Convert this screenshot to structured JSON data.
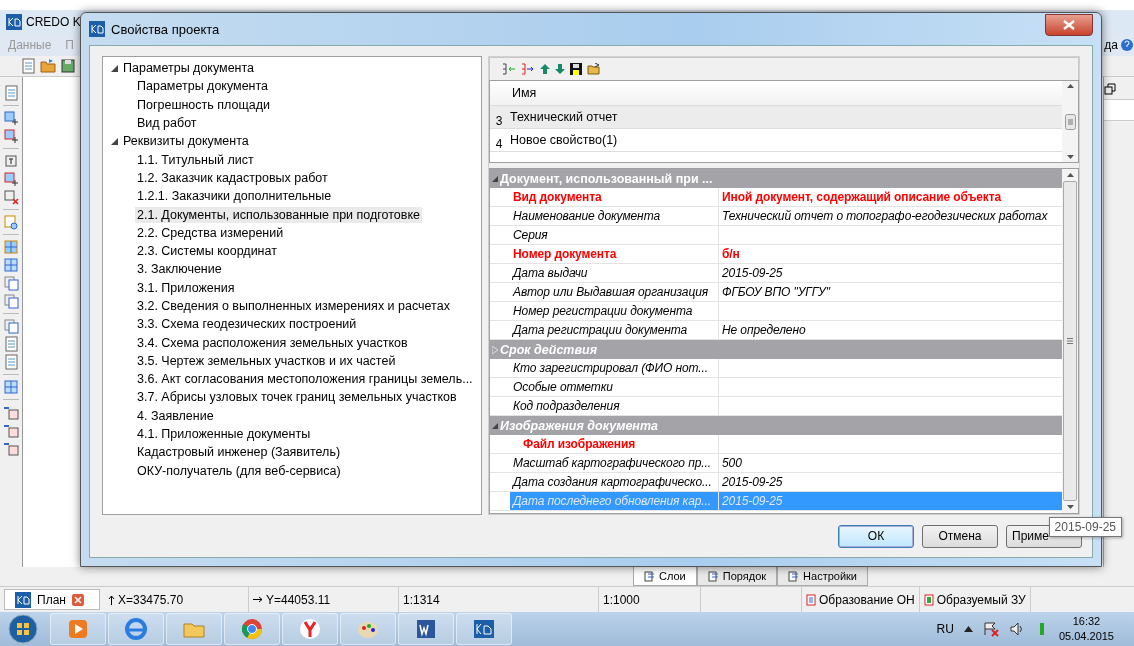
{
  "app": {
    "title": "CREDO K",
    "menu": [
      "Данные",
      "П"
    ],
    "menu_right": "да",
    "panel_tabs": [
      {
        "label": "Слои",
        "selected": true
      },
      {
        "label": "Порядок",
        "selected": false
      },
      {
        "label": "Настройки",
        "selected": false
      }
    ]
  },
  "dialog": {
    "title": "Свойства проекта",
    "tree": [
      {
        "label": "Параметры документа",
        "expanded": true,
        "selected": false,
        "children": [
          {
            "label": "Параметры документа",
            "selected": false
          },
          {
            "label": "Погрешность площади",
            "selected": false
          },
          {
            "label": "Вид работ",
            "selected": false
          }
        ]
      },
      {
        "label": "Реквизиты документа",
        "expanded": true,
        "selected": false,
        "children": [
          {
            "label": "1.1. Титульный лист",
            "selected": false
          },
          {
            "label": "1.2. Заказчик кадастровых работ",
            "selected": false
          },
          {
            "label": "1.2.1. Заказчики дополнительные",
            "selected": false
          },
          {
            "label": "2.1. Документы, использованные при подготовке",
            "selected": true
          },
          {
            "label": "2.2. Средства измерений",
            "selected": false
          },
          {
            "label": "2.3. Системы координат",
            "selected": false
          },
          {
            "label": "3. Заключение",
            "selected": false
          },
          {
            "label": "3.1. Приложения",
            "selected": false
          },
          {
            "label": "3.2. Сведения о выполненных измерениях и расчетах",
            "selected": false
          },
          {
            "label": "3.3. Схема геодезических построений",
            "selected": false
          },
          {
            "label": "3.4. Схема расположения земельных участков",
            "selected": false
          },
          {
            "label": "3.5. Чертеж земельных участков и их частей",
            "selected": false
          },
          {
            "label": "3.6. Акт согласования местоположения границы земель...",
            "selected": false
          },
          {
            "label": "3.7. Абрисы узловых точек границ земельных участков",
            "selected": false
          },
          {
            "label": "4. Заявление",
            "selected": false
          },
          {
            "label": "4.1. Приложенные документы",
            "selected": false
          },
          {
            "label": "Кадастровый инженер (Заявитель)",
            "selected": false
          },
          {
            "label": "ОКУ-получатель (для веб-сервиса)",
            "selected": false
          }
        ]
      }
    ],
    "list": {
      "columns": [
        "Имя"
      ],
      "rows": [
        {
          "number": "3",
          "name": "Технический отчет",
          "selected": true
        },
        {
          "number": "4",
          "name": "Новое свойство(1)",
          "selected": false
        }
      ]
    },
    "grid": {
      "label": "Документ, использованный при ...",
      "expanded": true,
      "rows": [
        {
          "kind": "property",
          "name": "Вид документа",
          "value": "Иной документ, содержащий описание объекта",
          "required": true,
          "selected": false
        },
        {
          "kind": "property",
          "name": "Наименование документа",
          "value": "Технический отчет о топографо-егодезических работах",
          "required": false,
          "selected": false
        },
        {
          "kind": "property",
          "name": "Серия",
          "required": false,
          "selected": false
        },
        {
          "kind": "property",
          "name": "Номер документа",
          "value": "б/н",
          "required": true,
          "selected": false
        },
        {
          "kind": "property",
          "name": "Дата выдачи",
          "value": "2015-09-25",
          "required": false,
          "selected": false
        },
        {
          "kind": "property",
          "name": "Автор или Выдавшая организация",
          "value": "ФГБОУ ВПО \"УГГУ\"",
          "required": false,
          "selected": false
        },
        {
          "kind": "property",
          "name": "Номер регистрации документа",
          "required": false,
          "selected": false
        },
        {
          "kind": "property",
          "name": "Дата регистрации документа",
          "value": "Не определено",
          "required": false,
          "selected": false
        },
        {
          "kind": "category",
          "label": "Срок действия",
          "expanded": false
        },
        {
          "kind": "property",
          "name": "Кто зарегистрировал (ФИО нот...",
          "required": false,
          "selected": false
        },
        {
          "kind": "property",
          "name": "Особые отметки",
          "required": false,
          "selected": false
        },
        {
          "kind": "property",
          "name": "Код подразделения",
          "required": false,
          "selected": false
        },
        {
          "kind": "category",
          "label": "Изображения документа",
          "expanded": true
        },
        {
          "kind": "file",
          "name": "Файл изображения",
          "required": true,
          "selected": false
        },
        {
          "kind": "property",
          "name": "Масштаб картографического пр...",
          "value": "500",
          "required": false,
          "selected": false
        },
        {
          "kind": "property",
          "name": "Дата создания картографическо...",
          "value": "2015-09-25",
          "required": false,
          "selected": false
        },
        {
          "kind": "property",
          "name": "Дата последнего обновления кар...",
          "value": "2015-09-25",
          "required": false,
          "selected": true
        }
      ]
    },
    "buttons": [
      {
        "label": "ОК",
        "default": true
      },
      {
        "label": "Отмена",
        "default": false
      },
      {
        "label": "Приме",
        "default": false
      }
    ],
    "tooltip": "2015-09-25"
  },
  "status_bar": {
    "tab": "План",
    "fields": [
      {
        "kind": "north",
        "text": "X=33475.70"
      },
      {
        "kind": "east",
        "text": "Y=44053.11"
      },
      {
        "kind": "plain",
        "text": "1:1314"
      },
      {
        "kind": "plain",
        "text": "1:1000"
      },
      {
        "kind": "plain"
      }
    ],
    "layers": [
      "Образование ОН",
      "Образуемый ЗУ"
    ]
  },
  "taskbar": {
    "language": "RU",
    "time": "16:32",
    "date": "05.04.2015"
  }
}
